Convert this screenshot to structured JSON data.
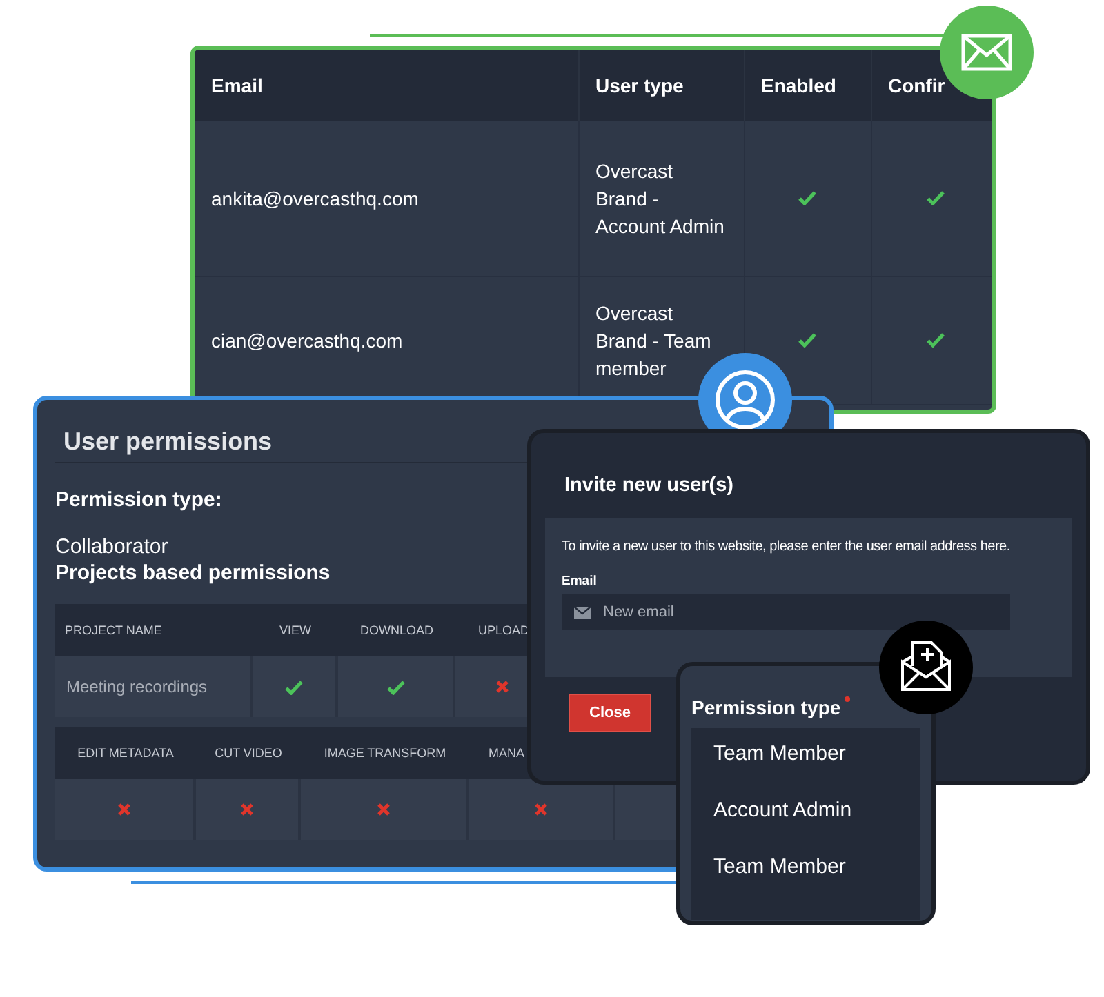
{
  "users_table": {
    "columns": [
      "Email",
      "User type",
      "Enabled",
      "Confir"
    ],
    "rows": [
      {
        "email": "ankita@overcasthq.com",
        "user_type": "Overcast Brand  - Account Admin",
        "enabled": true,
        "confirmed": true
      },
      {
        "email": "cian@overcasthq.com",
        "user_type": "Overcast Brand  - Team member",
        "enabled": true,
        "confirmed": true
      }
    ]
  },
  "user_permissions": {
    "title": "User permissions",
    "permission_type_label": "Permission type:",
    "permission_type": "Collaborator",
    "section_title": "Projects based permissions",
    "table_1": {
      "columns": [
        "PROJECT NAME",
        "VIEW",
        "DOWNLOAD",
        "UPLOAD"
      ],
      "rows": [
        {
          "project": "Meeting recordings",
          "cells": [
            {
              "allowed": true
            },
            {
              "allowed": true
            },
            {
              "allowed": false
            }
          ]
        }
      ]
    },
    "table_2": {
      "columns": [
        "EDIT METADATA",
        "CUT VIDEO",
        "IMAGE TRANSFORM",
        "MANA"
      ],
      "rows": [
        {
          "cells": [
            {
              "allowed": false
            },
            {
              "allowed": false
            },
            {
              "allowed": false
            },
            {
              "allowed": false
            }
          ]
        }
      ]
    }
  },
  "invite_dialog": {
    "title": "Invite new user(s)",
    "instructions": "To invite a new user to this website, please enter the user email address here.",
    "email_label": "Email",
    "email_placeholder": "New email",
    "close_button": "Close"
  },
  "permission_dropdown": {
    "label": "Permission type",
    "required": true,
    "options": [
      "Team Member",
      "Account Admin",
      "Team Member"
    ]
  }
}
